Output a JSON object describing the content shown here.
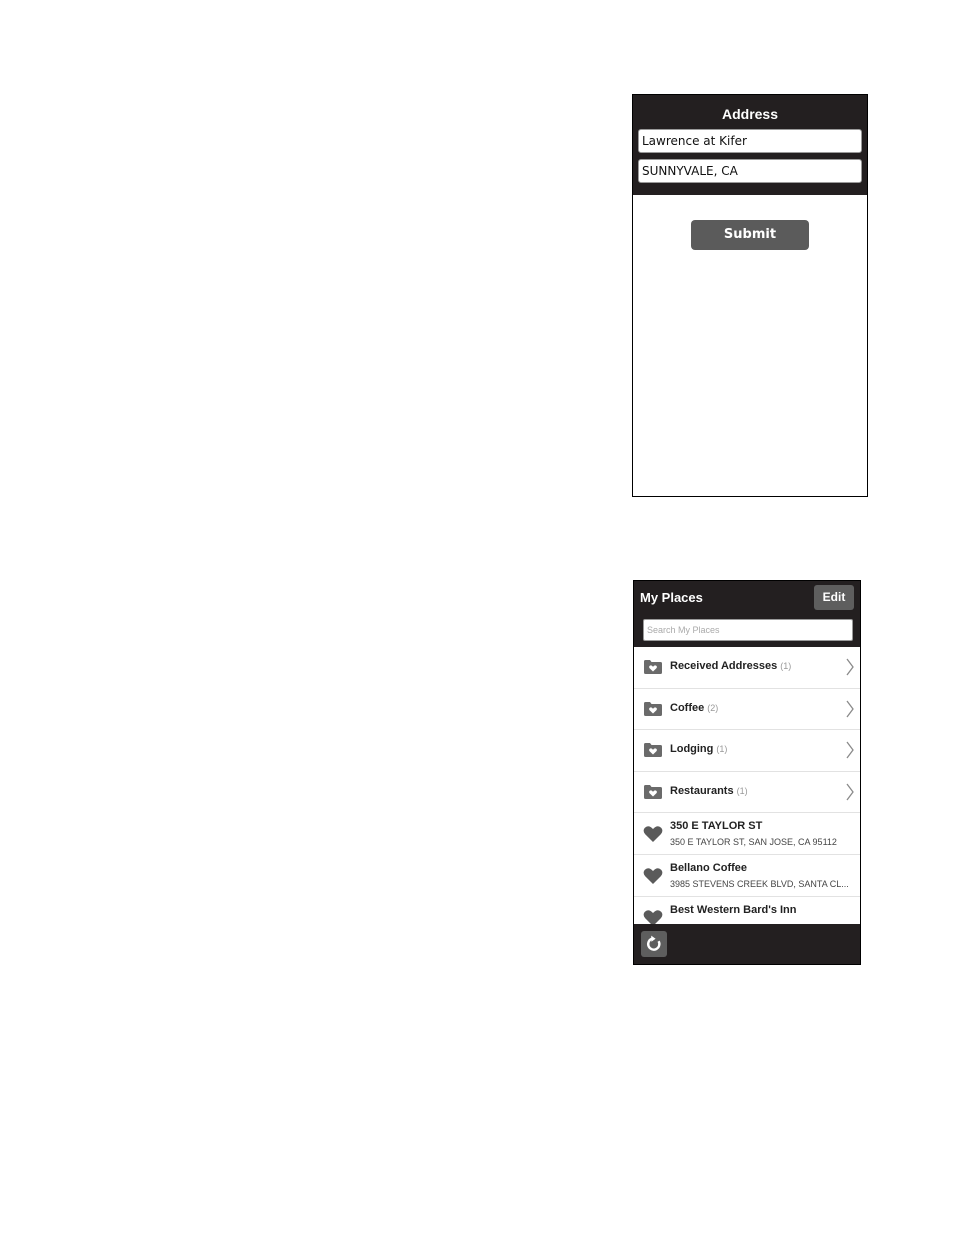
{
  "address_screen": {
    "title": "Address",
    "street_value": "Lawrence at Kifer",
    "city_value": "SUNNYVALE, CA",
    "submit_label": "Submit"
  },
  "places_screen": {
    "title": "My Places",
    "edit_label": "Edit",
    "search_placeholder": "Search My Places",
    "folders": [
      {
        "label": "Received Addresses",
        "count": "(1)"
      },
      {
        "label": "Coffee",
        "count": "(2)"
      },
      {
        "label": "Lodging",
        "count": "(1)"
      },
      {
        "label": "Restaurants",
        "count": "(1)"
      }
    ],
    "places": [
      {
        "name": "350 E TAYLOR ST",
        "address": "350 E TAYLOR ST, SAN JOSE, CA 95112"
      },
      {
        "name": "Bellano Coffee",
        "address": "3985 STEVENS CREEK BLVD, SANTA CL..."
      },
      {
        "name": "Best Western Bard's Inn",
        "address": ""
      }
    ]
  },
  "colors": {
    "header_bg": "#231f20",
    "button_bg": "#5b5b5b"
  },
  "icons": {
    "folder": "folder-heart-icon",
    "place": "heart-icon",
    "chevron": "chevron-right-icon",
    "refresh": "refresh-icon"
  }
}
